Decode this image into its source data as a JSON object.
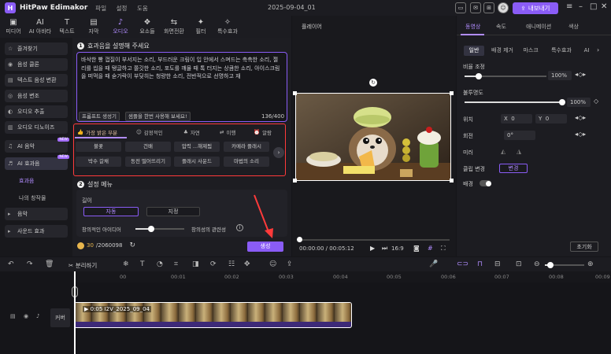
{
  "app": {
    "logo": "H",
    "name": "HitPaw Edimakor",
    "menus": [
      "파일",
      "설정",
      "도움"
    ],
    "window_title": "2025-09-04_01",
    "export": "내보내기"
  },
  "toolbar": [
    {
      "icon": "▣",
      "label": "미디어"
    },
    {
      "icon": "AI",
      "label": "AI 아바타"
    },
    {
      "icon": "T",
      "label": "텍스트"
    },
    {
      "icon": "▤",
      "label": "자막"
    },
    {
      "icon": "♪",
      "label": "오디오"
    },
    {
      "icon": "❖",
      "label": "요소들"
    },
    {
      "icon": "⇆",
      "label": "화면전환"
    },
    {
      "icon": "✦",
      "label": "필터"
    },
    {
      "icon": "✧",
      "label": "특수효과"
    }
  ],
  "sidebar": {
    "items": [
      "즐겨찾기",
      "음성 클론",
      "텍스트 음성 변환",
      "음성 변조",
      "오디오 추출",
      "오디오 디노이즈",
      "AI 음악",
      "AI 효과음",
      "음악",
      "사운드 효과"
    ],
    "subs": [
      "효과음",
      "나의 창작물"
    ],
    "new": "NEW"
  },
  "section1": {
    "num": "1",
    "title": "효과음을 설명해 주세요",
    "prompt": "바삭한 빵 껍질이 부서지는 소리, 부드러운 크림이 입 안에서 스며드는 촉촉한 소리, 젤리를 씹을 때 탱글하고 쫄깃한 소리, 포도를 깨물 때 톡 터지는 상큼한 소리, 아이스크림을 떠먹을 때 숟가락이 부딪히는 청량한 소리, 전반적으로 선명하고 재",
    "btn_generate": "프롬프트 생성기",
    "btn_sample": "샘플을 한번 사용해 보세요!",
    "count": "136/400"
  },
  "categories": [
    "가장 밝은 부분",
    "감정적인",
    "자연",
    "이행",
    "알람"
  ],
  "chips": [
    "불꽃",
    "건배",
    "압력 ...해제됨",
    "카메라 플래시",
    "박수 갈채",
    "동전 떨어뜨리기",
    "플래시 사운드",
    "마법의 소리"
  ],
  "section2": {
    "num": "2",
    "title": "설정 메뉴",
    "length_label": "길이",
    "auto": "자동",
    "custom": "지정",
    "creativity": "창의적인 아이디어",
    "relevance": "창의성의 관련성"
  },
  "credits": {
    "used": "30",
    "total": "/2060098"
  },
  "generate": "생성",
  "player": {
    "title": "플레이어",
    "time": "00:00:00 / 00:05:12",
    "ratio": "16:9"
  },
  "right": {
    "tabs": [
      "동영상",
      "속도",
      "애니메이션",
      "색상"
    ],
    "subs": [
      "일반",
      "배경 제거",
      "마스크",
      "특수효과",
      "AI"
    ],
    "scale": "비율 조정",
    "scale_val": "100%",
    "opacity": "불투명도",
    "opacity_val": "100%",
    "position": "위치",
    "x": "X",
    "xv": "0",
    "y": "Y",
    "yv": "0",
    "rotate": "회전",
    "rotv": "0°",
    "mirror": "미러",
    "replace": "클립 변경",
    "replace_btn": "변경",
    "bg": "배경",
    "reset": "초기화"
  },
  "timeline": {
    "split": "분리하기",
    "ticks": [
      "00",
      "00:01",
      "00:02",
      "00:03",
      "00:04",
      "00:05",
      "00:06",
      "00:07",
      "00:08",
      "00:09"
    ],
    "clip": "0:05 I2V_2025_09_04",
    "cover": "커버"
  },
  "colors": {
    "accent": "#8a5cf6",
    "highlight": "#ff3a3a"
  }
}
